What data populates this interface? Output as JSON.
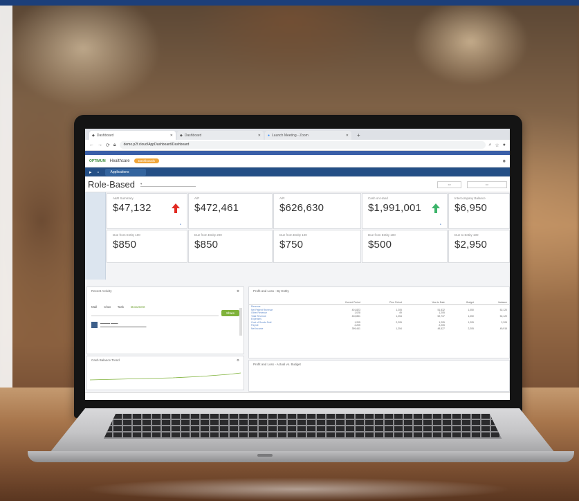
{
  "browser": {
    "tabs": [
      {
        "label": "Dashboard",
        "active": true
      },
      {
        "label": "Dashboard",
        "active": false
      },
      {
        "label": "Launch Meeting - Zoom",
        "active": false
      }
    ],
    "url": "demo.p2f.cloud/AppDashboard/Dashboard"
  },
  "app": {
    "logo_text": "OPTIMUM",
    "name": "Healthcare",
    "pill_label": "Dashboards",
    "nav_tab": "Applications"
  },
  "dashboard": {
    "title": "Role-Based",
    "tiles_row1": [
      {
        "label": "A&R Summary",
        "value": "$47,132",
        "trend": "up-red"
      },
      {
        "label": "A/P",
        "value": "$472,461",
        "trend": "none"
      },
      {
        "label": "A/R",
        "value": "$626,630",
        "trend": "none"
      },
      {
        "label": "Cash on Hand",
        "value": "$1,991,001",
        "trend": "up-green"
      },
      {
        "label": "Intercompany Balance",
        "value": "$6,950",
        "trend": "none"
      }
    ],
    "tiles_row2": [
      {
        "label": "Due from Entity 100",
        "value": "$850"
      },
      {
        "label": "Due from Entity 200",
        "value": "$850"
      },
      {
        "label": "Due from Entity 100",
        "value": "$750"
      },
      {
        "label": "Due from Entity 100",
        "value": "$500"
      },
      {
        "label": "Due to Entity 100",
        "value": "$2,950"
      }
    ]
  },
  "panels": {
    "left_top_title": "Recent Activity",
    "radio_options": [
      "Mail",
      "Chat",
      "Task",
      "Document"
    ],
    "go_label": "Share",
    "trend_title": "Cash Balance Trend",
    "report_title": "Profit and Loss - By Entity",
    "report2_title": "Profit and Loss - Actual vs. Budget",
    "report_columns": [
      "",
      "Current Period",
      "Prior Period",
      "Year to Date",
      "Budget",
      "Variance"
    ],
    "report_rows": [
      [
        "Revenue",
        "",
        "",
        "",
        "",
        ""
      ],
      [
        "Net Patient Revenue",
        "401,823",
        "1,205",
        "51,532",
        "1,050",
        "52,120"
      ],
      [
        "Other Revenue",
        "1,028",
        "49",
        "1,205",
        "",
        ""
      ],
      [
        "Total Revenue",
        "402,851",
        "1,254",
        "52,737",
        "1,050",
        "52,120"
      ],
      [
        "Expenses",
        "",
        "",
        "",
        "",
        ""
      ],
      [
        "Cost of Goods Sold",
        "1,205",
        "2,205",
        "1,205",
        "1,205",
        "2,205"
      ],
      [
        "Payroll",
        "2,205",
        "",
        "2,205",
        "",
        ""
      ],
      [
        "Net Income",
        "399,441",
        "1,254",
        "49,327",
        "2,205",
        "49,915"
      ]
    ]
  }
}
